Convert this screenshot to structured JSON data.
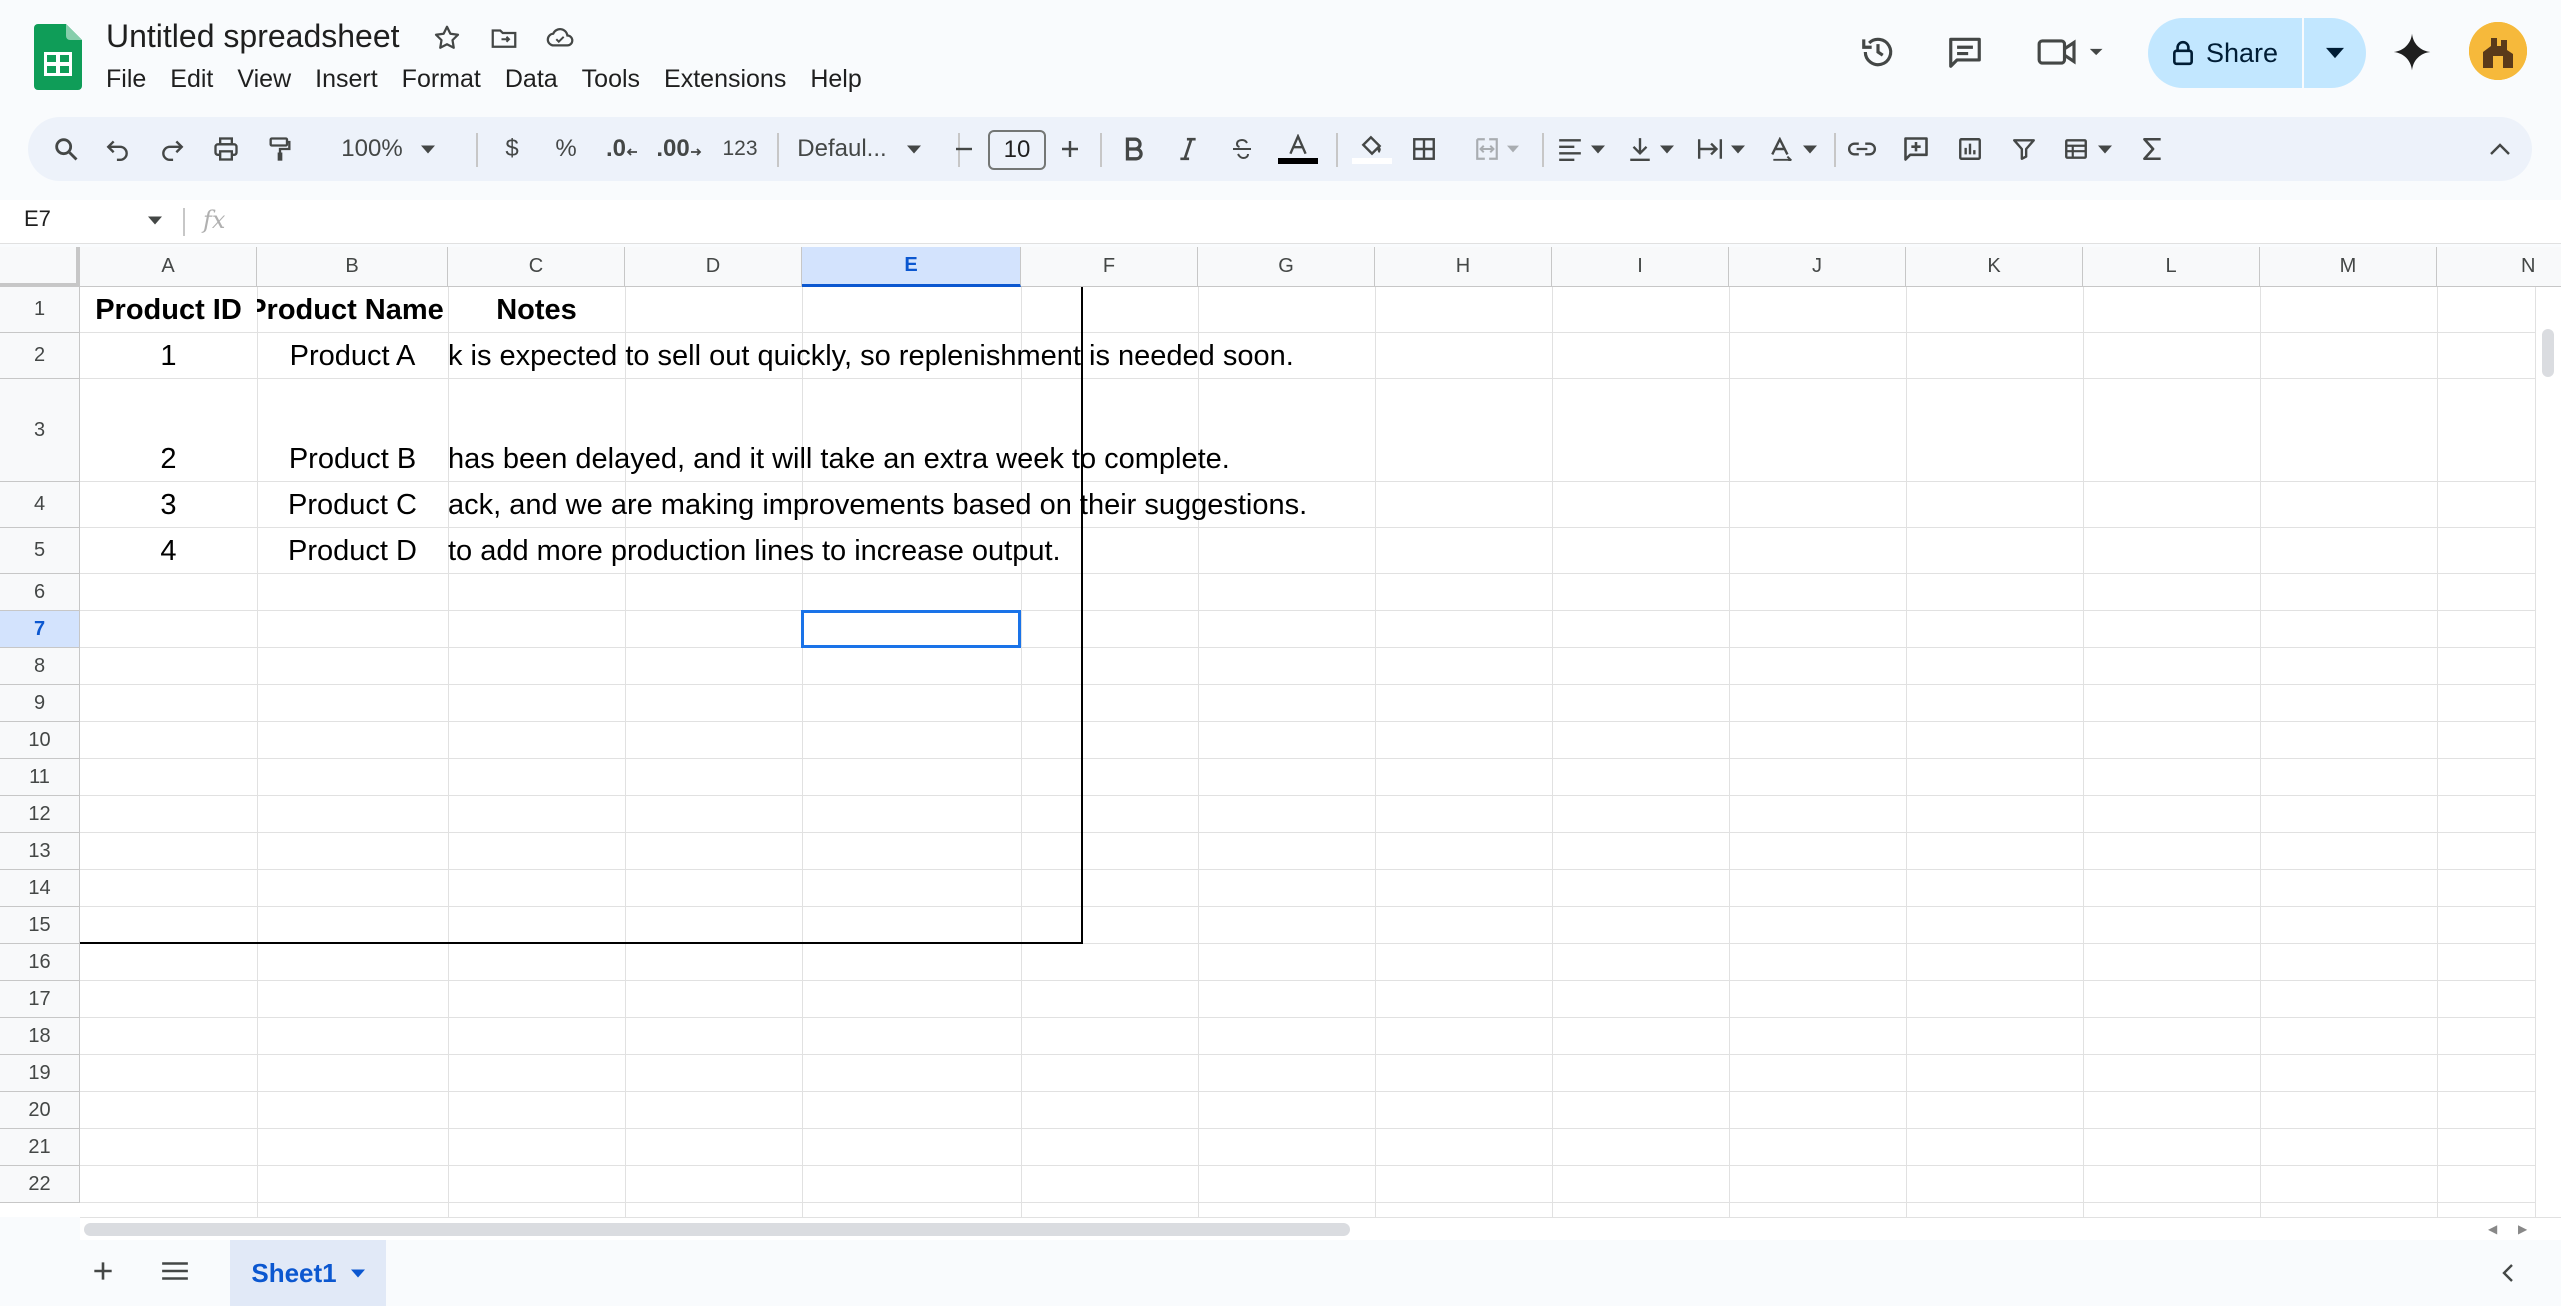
{
  "app": {
    "title": "Untitled spreadsheet",
    "menu": [
      "File",
      "Edit",
      "View",
      "Insert",
      "Format",
      "Data",
      "Tools",
      "Extensions",
      "Help"
    ],
    "share_label": "Share",
    "brand_color": "#0f9d58",
    "accent_color": "#0b57d0"
  },
  "toolbar": {
    "zoom": "100%",
    "currency": "$",
    "percent": "%",
    "decrease_decimals": ".0",
    "increase_decimals": ".00",
    "more_formats": "123",
    "font": "Defaul...",
    "font_size": "10"
  },
  "formula_bar": {
    "cell_ref": "E7",
    "fx": "fx",
    "value": ""
  },
  "grid": {
    "columns": [
      "A",
      "B",
      "C",
      "D",
      "E",
      "F",
      "G",
      "H",
      "I",
      "J",
      "K",
      "L",
      "M",
      "N"
    ],
    "selected_column": "E",
    "rows": [
      "1",
      "2",
      "3",
      "4",
      "5",
      "6",
      "7",
      "8",
      "9",
      "10",
      "11",
      "12",
      "13",
      "14",
      "15",
      "16",
      "17",
      "18",
      "19",
      "20",
      "21",
      "22"
    ],
    "selected_row": "7",
    "header": {
      "a": "Product ID",
      "b": "Product Name",
      "c": "Notes"
    },
    "data": [
      {
        "id": "1",
        "name": "Product A",
        "notes": "k is expected to sell out quickly, so replenishment is needed soon."
      },
      {
        "id": "2",
        "name": "Product B",
        "notes": "has been delayed, and it will take an extra week to complete."
      },
      {
        "id": "3",
        "name": "Product C",
        "notes": "ack, and we are making improvements based on their suggestions."
      },
      {
        "id": "4",
        "name": "Product D",
        "notes": "to add more production lines to increase output."
      }
    ]
  },
  "sheets": {
    "active": "Sheet1"
  }
}
